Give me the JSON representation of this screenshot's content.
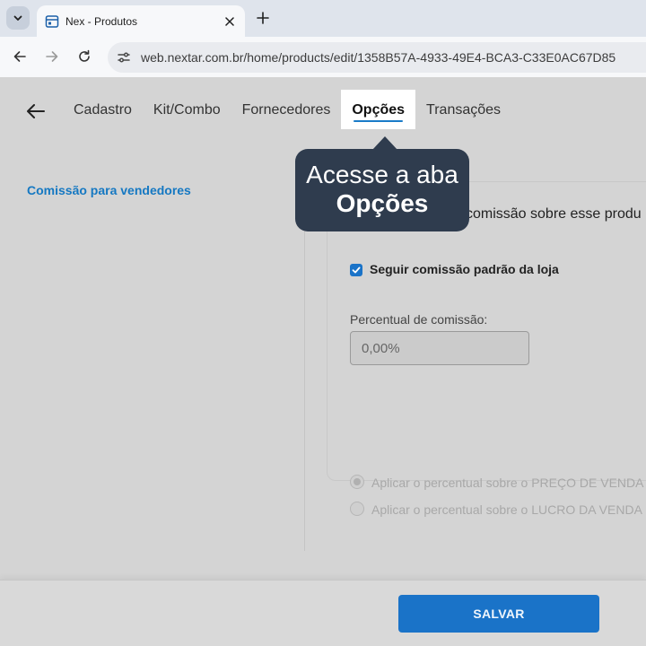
{
  "browser": {
    "tab_title": "Nex - Produtos",
    "url": "web.nextar.com.br/home/products/edit/1358B57A-4933-49E4-BCA3-C33E0AC67D85"
  },
  "nav": {
    "tabs": [
      {
        "label": "Cadastro",
        "active": false
      },
      {
        "label": "Kit/Combo",
        "active": false
      },
      {
        "label": "Fornecedores",
        "active": false
      },
      {
        "label": "Opções",
        "active": true
      },
      {
        "label": "Transações",
        "active": false
      }
    ]
  },
  "sidebar": {
    "link": "Comissão para vendedores"
  },
  "card": {
    "heading": "comissão sobre esse produ",
    "checkbox_label": "Seguir comissão padrão da loja",
    "checkbox_checked": true,
    "field_label": "Percentual de comissão:",
    "field_value": "0,00%",
    "radio_options": [
      {
        "label": "Aplicar o percentual sobre o PREÇO DE VENDA",
        "selected": true
      },
      {
        "label": "Aplicar o percentual sobre o LUCRO DA VENDA",
        "selected": false
      }
    ]
  },
  "footer": {
    "save_label": "SALVAR"
  },
  "callout": {
    "line1": "Acesse a aba",
    "line2": "Opções"
  },
  "colors": {
    "accent": "#1a73c8",
    "callout_bg": "#2f3c4e",
    "link": "#1578c2"
  }
}
